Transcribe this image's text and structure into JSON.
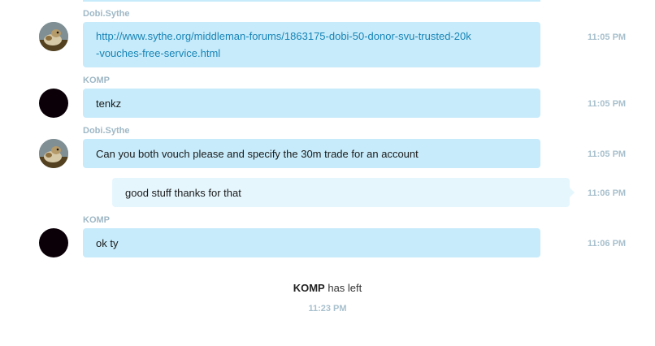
{
  "messages": [
    {
      "sender": "Dobi.Sythe",
      "link_line1": "http://www.sythe.org/middleman-forums/1863175-dobi-50-donor-svu-trusted-20k",
      "link_line2": "-vouches-free-service.html",
      "time": "11:05 PM"
    },
    {
      "sender": "KOMP",
      "text": "tenkz",
      "time": "11:05 PM"
    },
    {
      "sender": "Dobi.Sythe",
      "text": "Can you both vouch please and specify the 30m trade for an account",
      "time": "11:05 PM"
    },
    {
      "text": "good stuff thanks for that",
      "time": "11:06 PM"
    },
    {
      "sender": "KOMP",
      "text": "ok ty",
      "time": "11:06 PM"
    }
  ],
  "system_event": {
    "user": "KOMP",
    "action": "has left",
    "time": "11:23 PM"
  },
  "colors": {
    "bubble_incoming": "#c7ebfa",
    "bubble_outgoing": "#e6f6fd",
    "link": "#1784b7",
    "sender": "#9fb8c6"
  }
}
